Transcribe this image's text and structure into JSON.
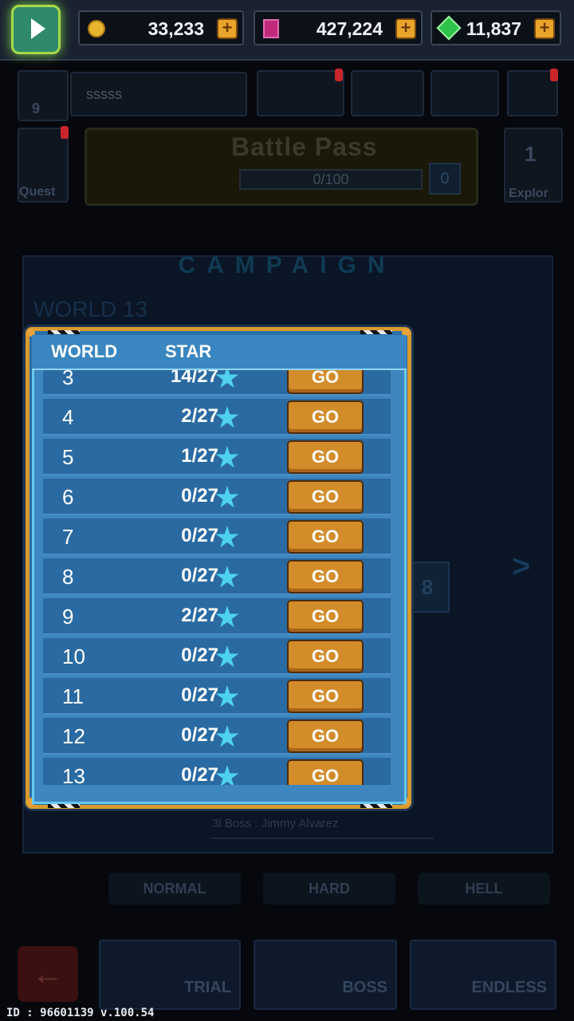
{
  "currencies": [
    {
      "icon": "gold-coin-icon",
      "value": "33,233"
    },
    {
      "icon": "pink-gem-icon",
      "value": "427,224"
    },
    {
      "icon": "green-gem-icon",
      "value": "11,837"
    }
  ],
  "profile": {
    "name": "sssss",
    "level": "9"
  },
  "quest_label": "Quest",
  "battle_pass": {
    "title": "Battle Pass",
    "progress": "0/100",
    "level": "0"
  },
  "explore": {
    "label": "Explor",
    "value": "1"
  },
  "campaign": {
    "title": "CAMPAIGN",
    "world_label": "WORLD 13",
    "boss_text": "3l Boss : Jimmy Alvarez",
    "stage_num": "8"
  },
  "modes": [
    "NORMAL",
    "HARD",
    "HELL"
  ],
  "bottom": {
    "trial": "TRIAL",
    "boss": "BOSS",
    "endless": "ENDLESS"
  },
  "popup": {
    "col_world": "WORLD",
    "col_star": "STAR",
    "go_label": "GO",
    "rows": [
      {
        "world": "3",
        "stars": "14/27"
      },
      {
        "world": "4",
        "stars": "2/27"
      },
      {
        "world": "5",
        "stars": "1/27"
      },
      {
        "world": "6",
        "stars": "0/27"
      },
      {
        "world": "7",
        "stars": "0/27"
      },
      {
        "world": "8",
        "stars": "0/27"
      },
      {
        "world": "9",
        "stars": "2/27"
      },
      {
        "world": "10",
        "stars": "0/27"
      },
      {
        "world": "11",
        "stars": "0/27"
      },
      {
        "world": "12",
        "stars": "0/27"
      },
      {
        "world": "13",
        "stars": "0/27"
      }
    ]
  },
  "footer_id": "ID : 96601139 v.100.54"
}
